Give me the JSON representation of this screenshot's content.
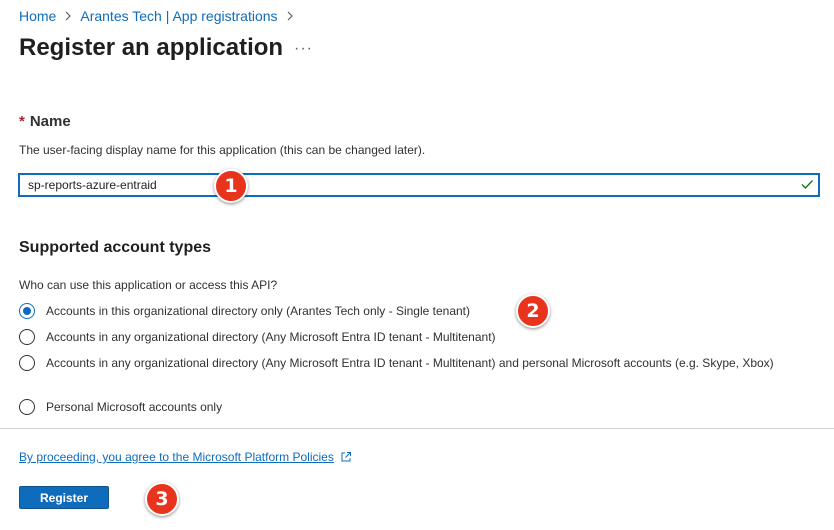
{
  "breadcrumb": {
    "home": "Home",
    "parent": "Arantes Tech | App registrations"
  },
  "page": {
    "title": "Register an application",
    "more": "···"
  },
  "name_field": {
    "required_mark": "*",
    "label": "Name",
    "help": "The user-facing display name for this application (this can be changed later).",
    "value": "sp-reports-azure-entraid",
    "valid": true
  },
  "account_types": {
    "title": "Supported account types",
    "question": "Who can use this application or access this API?",
    "selected_index": 0,
    "options": [
      "Accounts in this organizational directory only (Arantes Tech only - Single tenant)",
      "Accounts in any organizational directory (Any Microsoft Entra ID tenant - Multitenant)",
      "Accounts in any organizational directory (Any Microsoft Entra ID tenant - Multitenant) and personal Microsoft accounts (e.g. Skype, Xbox)",
      "Personal Microsoft accounts only"
    ]
  },
  "footer": {
    "policy_link": "By proceeding, you agree to the Microsoft Platform Policies",
    "register_label": "Register"
  },
  "annotations": {
    "step1": "1",
    "step2": "2",
    "step3": "3"
  },
  "colors": {
    "accent": "#0f6cbd",
    "required": "#a4262c",
    "valid_check": "#107c10",
    "annotation_badge": "#e8331d"
  }
}
